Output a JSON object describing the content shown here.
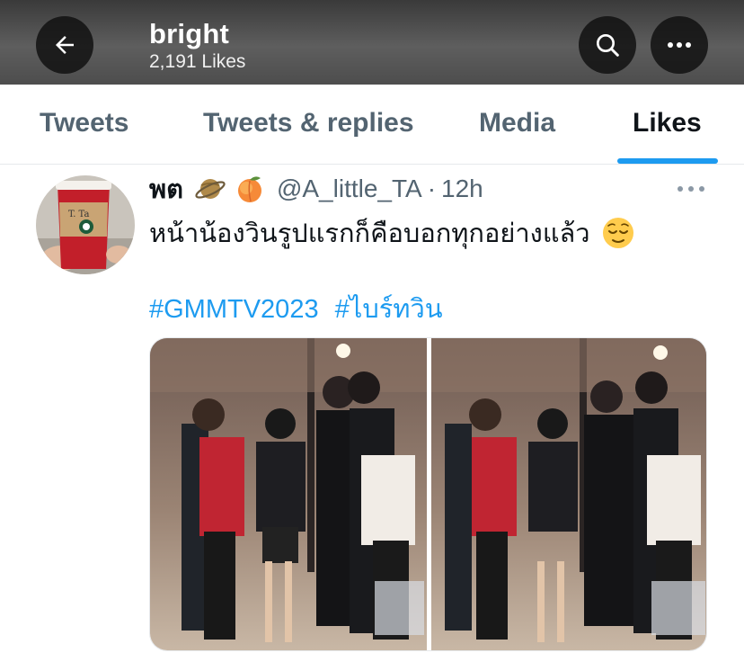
{
  "header": {
    "title": "bright",
    "subtitle": "2,191 Likes",
    "back_icon": "arrow-left-icon",
    "search_icon": "search-icon",
    "more_icon": "more-horizontal-icon",
    "background_color": "#4a4a4a"
  },
  "tabs": [
    {
      "label": "Tweets",
      "active": false
    },
    {
      "label": "Tweets & replies",
      "active": false
    },
    {
      "label": "Media",
      "active": false
    },
    {
      "label": "Likes",
      "active": true
    }
  ],
  "colors": {
    "accent": "#1d9bf0",
    "text_primary": "#0f1419",
    "text_secondary": "#536471"
  },
  "tweet": {
    "author_name": "พต",
    "author_emojis": [
      "ringed-planet-emoji",
      "peach-emoji"
    ],
    "handle": "@A_little_TA",
    "separator": "·",
    "time": "12h",
    "text": "หน้าน้องวินรูปแรกก็คือบอกทุกอย่างแล้ว",
    "text_emoji": "relieved-face-emoji",
    "hashtags": [
      "#GMMTV2023",
      "#ไบร์ทวิน"
    ],
    "avatar": {
      "description": "red cup",
      "cup_label": "T. Ta"
    },
    "media_count": 2
  }
}
